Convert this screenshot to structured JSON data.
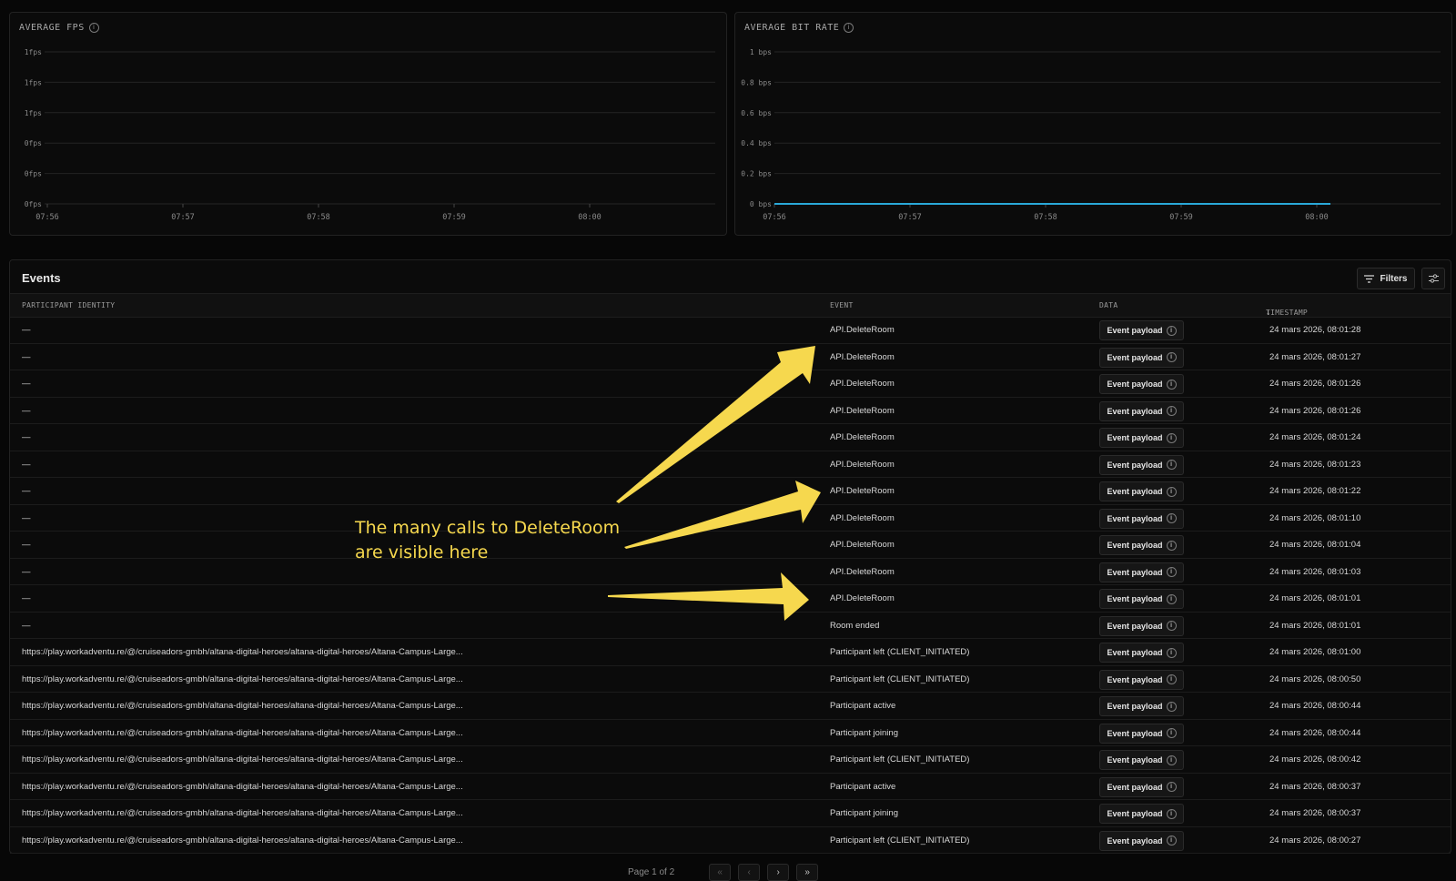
{
  "fps_chart": {
    "title": "AVERAGE FPS",
    "y_ticks": [
      "1fps",
      "1fps",
      "1fps",
      "0fps",
      "0fps",
      "0fps"
    ],
    "x_ticks": [
      "07:56",
      "07:57",
      "07:58",
      "07:59",
      "08:00"
    ]
  },
  "bitrate_chart": {
    "title": "AVERAGE BIT RATE",
    "y_ticks": [
      "1 bps",
      "0.8 bps",
      "0.6 bps",
      "0.4 bps",
      "0.2 bps",
      "0 bps"
    ],
    "x_ticks": [
      "07:56",
      "07:57",
      "07:58",
      "07:59",
      "08:00"
    ],
    "line_color": "#2aa8d8"
  },
  "chart_data": [
    {
      "type": "line",
      "title": "AVERAGE FPS",
      "x": [
        "07:56",
        "07:57",
        "07:58",
        "07:59",
        "08:00"
      ],
      "series": [
        {
          "values": []
        }
      ]
    },
    {
      "type": "line",
      "title": "AVERAGE BIT RATE",
      "x": [
        "07:56",
        "07:57",
        "07:58",
        "07:59",
        "08:00"
      ],
      "ylim": [
        0,
        1
      ],
      "series": [
        {
          "values": [
            0,
            0,
            0,
            0,
            0
          ]
        }
      ]
    }
  ],
  "events": {
    "title": "Events",
    "filters_label": "Filters",
    "columns": {
      "participant": "PARTICIPANT IDENTITY",
      "event": "EVENT",
      "data": "DATA",
      "timestamp": "TIMESTAMP"
    },
    "payload_label": "Event payload",
    "rows": [
      {
        "participant": "—",
        "event": "API.DeleteRoom",
        "timestamp": "24 mars 2026, 08:01:28"
      },
      {
        "participant": "—",
        "event": "API.DeleteRoom",
        "timestamp": "24 mars 2026, 08:01:27"
      },
      {
        "participant": "—",
        "event": "API.DeleteRoom",
        "timestamp": "24 mars 2026, 08:01:26"
      },
      {
        "participant": "—",
        "event": "API.DeleteRoom",
        "timestamp": "24 mars 2026, 08:01:26"
      },
      {
        "participant": "—",
        "event": "API.DeleteRoom",
        "timestamp": "24 mars 2026, 08:01:24"
      },
      {
        "participant": "—",
        "event": "API.DeleteRoom",
        "timestamp": "24 mars 2026, 08:01:23"
      },
      {
        "participant": "—",
        "event": "API.DeleteRoom",
        "timestamp": "24 mars 2026, 08:01:22"
      },
      {
        "participant": "—",
        "event": "API.DeleteRoom",
        "timestamp": "24 mars 2026, 08:01:10"
      },
      {
        "participant": "—",
        "event": "API.DeleteRoom",
        "timestamp": "24 mars 2026, 08:01:04"
      },
      {
        "participant": "—",
        "event": "API.DeleteRoom",
        "timestamp": "24 mars 2026, 08:01:03"
      },
      {
        "participant": "—",
        "event": "API.DeleteRoom",
        "timestamp": "24 mars 2026, 08:01:01"
      },
      {
        "participant": "—",
        "event": "Room ended",
        "timestamp": "24 mars 2026, 08:01:01"
      },
      {
        "participant": "https://play.workadventu.re/@/cruiseadors-gmbh/altana-digital-heroes/altana-digital-heroes/Altana-Campus-Large...",
        "event": "Participant left (CLIENT_INITIATED)",
        "timestamp": "24 mars 2026, 08:01:00"
      },
      {
        "participant": "https://play.workadventu.re/@/cruiseadors-gmbh/altana-digital-heroes/altana-digital-heroes/Altana-Campus-Large...",
        "event": "Participant left (CLIENT_INITIATED)",
        "timestamp": "24 mars 2026, 08:00:50"
      },
      {
        "participant": "https://play.workadventu.re/@/cruiseadors-gmbh/altana-digital-heroes/altana-digital-heroes/Altana-Campus-Large...",
        "event": "Participant active",
        "timestamp": "24 mars 2026, 08:00:44"
      },
      {
        "participant": "https://play.workadventu.re/@/cruiseadors-gmbh/altana-digital-heroes/altana-digital-heroes/Altana-Campus-Large...",
        "event": "Participant joining",
        "timestamp": "24 mars 2026, 08:00:44"
      },
      {
        "participant": "https://play.workadventu.re/@/cruiseadors-gmbh/altana-digital-heroes/altana-digital-heroes/Altana-Campus-Large...",
        "event": "Participant left (CLIENT_INITIATED)",
        "timestamp": "24 mars 2026, 08:00:42"
      },
      {
        "participant": "https://play.workadventu.re/@/cruiseadors-gmbh/altana-digital-heroes/altana-digital-heroes/Altana-Campus-Large...",
        "event": "Participant active",
        "timestamp": "24 mars 2026, 08:00:37"
      },
      {
        "participant": "https://play.workadventu.re/@/cruiseadors-gmbh/altana-digital-heroes/altana-digital-heroes/Altana-Campus-Large...",
        "event": "Participant joining",
        "timestamp": "24 mars 2026, 08:00:37"
      },
      {
        "participant": "https://play.workadventu.re/@/cruiseadors-gmbh/altana-digital-heroes/altana-digital-heroes/Altana-Campus-Large...",
        "event": "Participant left (CLIENT_INITIATED)",
        "timestamp": "24 mars 2026, 08:00:27"
      }
    ]
  },
  "pagination": {
    "label": "Page 1 of 2",
    "first": "«",
    "prev": "‹",
    "next": "›",
    "last": "»"
  },
  "annotation": {
    "line1": "The many calls to DeleteRoom",
    "line2": "are visible here",
    "color": "#f6d84e"
  }
}
